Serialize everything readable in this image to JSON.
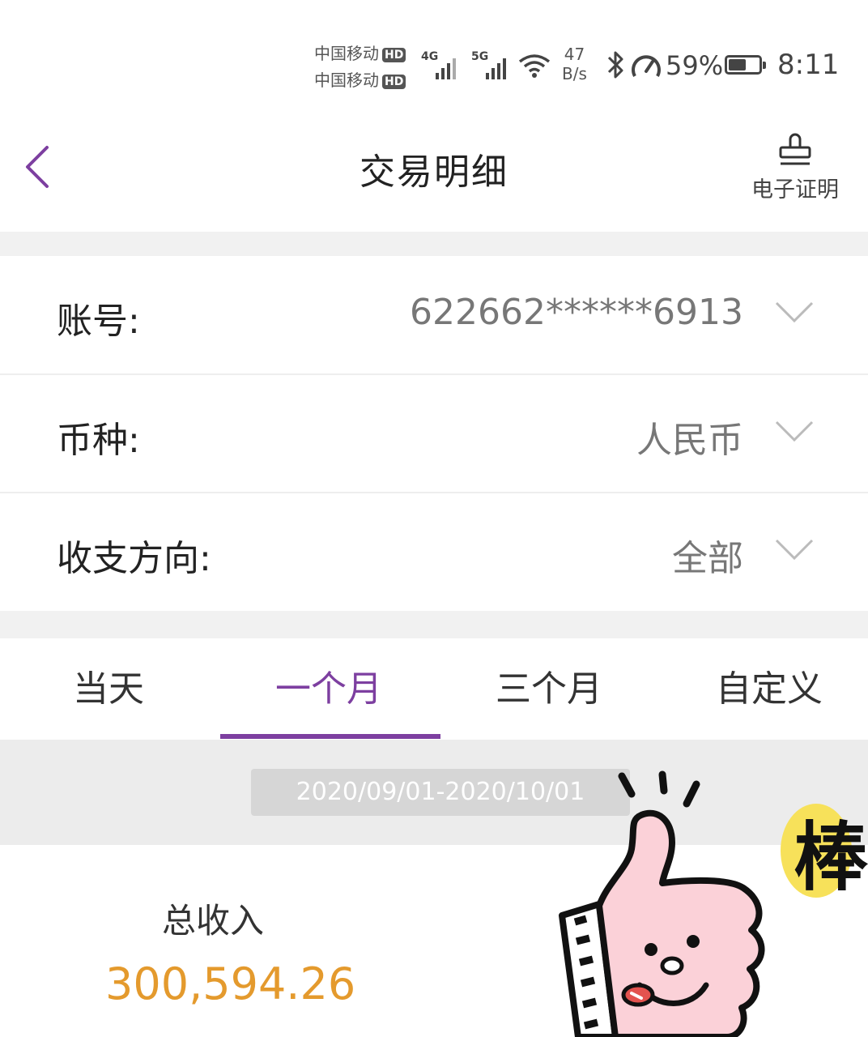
{
  "status_bar": {
    "carrier1": "中国移动",
    "carrier2": "中国移动",
    "hd_badge": "HD",
    "sig1_tag": "4G",
    "sig2_tag": "5G",
    "net_speed_value": "47",
    "net_speed_unit": "B/s",
    "battery_percent": "59%",
    "battery_level": 0.59,
    "time": "8:11"
  },
  "header": {
    "title": "交易明细",
    "cert_label": "电子证明"
  },
  "filters": {
    "account": {
      "label": "账号:",
      "value": "622662******6913"
    },
    "currency": {
      "label": "币种:",
      "value": "人民币"
    },
    "direction": {
      "label": "收支方向:",
      "value": "全部"
    }
  },
  "tabs": [
    {
      "label": "当天"
    },
    {
      "label": "一个月",
      "active": true
    },
    {
      "label": "三个月"
    },
    {
      "label": "自定义"
    }
  ],
  "date_range": "2020/09/01-2020/10/01",
  "summary": {
    "income_label": "总收入",
    "income_value": "300,594.26"
  },
  "sticker": {
    "text": "棒"
  },
  "colors": {
    "accent": "#7d3fa0",
    "amount": "#e49a2d",
    "gap": "#f1f1f1"
  }
}
